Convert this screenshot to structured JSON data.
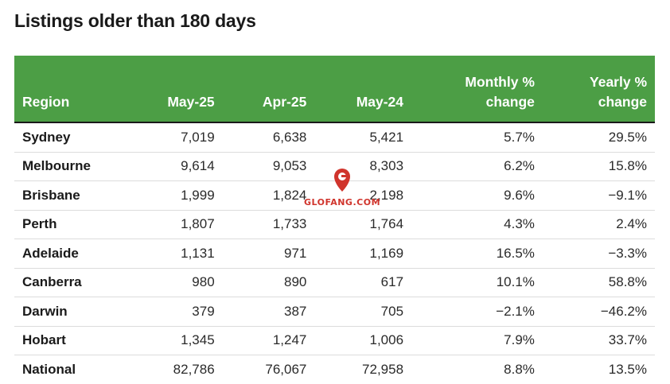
{
  "title": "Listings older than 180 days",
  "columns": {
    "region": "Region",
    "may25": "May-25",
    "apr25": "Apr-25",
    "may24": "May-24",
    "monthly_line1": "Monthly %",
    "monthly_line2": "change",
    "yearly_line1": "Yearly %",
    "yearly_line2": "change"
  },
  "rows": [
    {
      "region": "Sydney",
      "may25": "7,019",
      "apr25": "6,638",
      "may24": "5,421",
      "monthly": "5.7%",
      "yearly": "29.5%"
    },
    {
      "region": "Melbourne",
      "may25": "9,614",
      "apr25": "9,053",
      "may24": "8,303",
      "monthly": "6.2%",
      "yearly": "15.8%"
    },
    {
      "region": "Brisbane",
      "may25": "1,999",
      "apr25": "1,824",
      "may24": "2,198",
      "monthly": "9.6%",
      "yearly": "−9.1%"
    },
    {
      "region": "Perth",
      "may25": "1,807",
      "apr25": "1,733",
      "may24": "1,764",
      "monthly": "4.3%",
      "yearly": "2.4%"
    },
    {
      "region": "Adelaide",
      "may25": "1,131",
      "apr25": "971",
      "may24": "1,169",
      "monthly": "16.5%",
      "yearly": "−3.3%"
    },
    {
      "region": "Canberra",
      "may25": "980",
      "apr25": "890",
      "may24": "617",
      "monthly": "10.1%",
      "yearly": "58.8%"
    },
    {
      "region": "Darwin",
      "may25": "379",
      "apr25": "387",
      "may24": "705",
      "monthly": "−2.1%",
      "yearly": "−46.2%"
    },
    {
      "region": "Hobart",
      "may25": "1,345",
      "apr25": "1,247",
      "may24": "1,006",
      "monthly": "7.9%",
      "yearly": "33.7%"
    },
    {
      "region": "National",
      "may25": "82,786",
      "apr25": "76,067",
      "may24": "72,958",
      "monthly": "8.8%",
      "yearly": "13.5%"
    }
  ],
  "watermark": {
    "text": "GLOFANG.COM",
    "color": "#d0342c"
  },
  "colors": {
    "header_bg": "#4c9e45",
    "header_text": "#ffffff"
  }
}
